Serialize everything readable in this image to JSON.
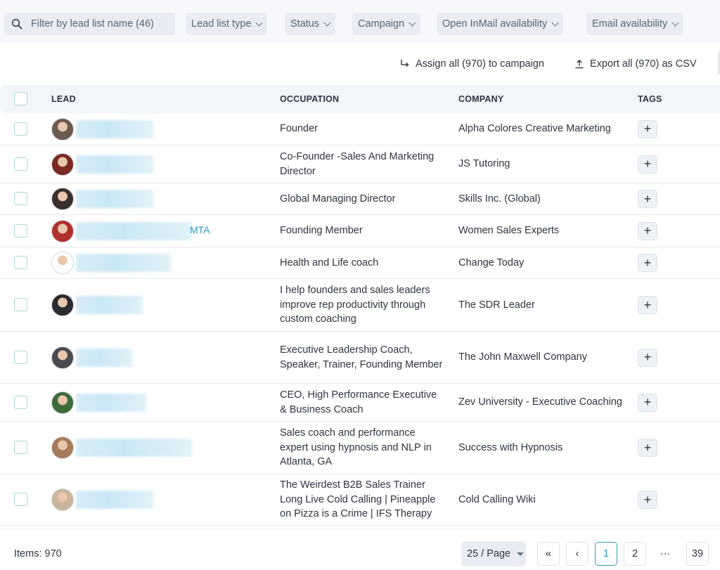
{
  "filters": {
    "search_placeholder": "Filter by lead list name (46)",
    "chips": [
      {
        "label": "Lead list type"
      },
      {
        "label": "Status"
      },
      {
        "label": "Campaign"
      },
      {
        "label": "Open InMail availability"
      },
      {
        "label": "Email availability"
      }
    ]
  },
  "actions": {
    "assign_label": "Assign all (970) to campaign",
    "export_label": "Export all (970) as CSV"
  },
  "table": {
    "columns": [
      "LEAD",
      "OCCUPATION",
      "COMPANY",
      "TAGS"
    ],
    "rows": [
      {
        "lead_suffix": "",
        "occupation": "Founder",
        "company": "Alpha Colores Creative Marketing",
        "tag_label": "+",
        "avatar_color": "#6b5a4e"
      },
      {
        "lead_suffix": "",
        "occupation": "Co-Founder -Sales And Marketing Director",
        "company": "JS Tutoring",
        "tag_label": "+",
        "avatar_color": "#7a2a22"
      },
      {
        "lead_suffix": "",
        "occupation": "Global Managing Director",
        "company": "Skills Inc. (Global)",
        "tag_label": "+",
        "avatar_color": "#3a2e2a"
      },
      {
        "lead_suffix": "MTA",
        "occupation": "Founding Member",
        "company": "Women Sales Experts",
        "tag_label": "+",
        "avatar_color": "#b0302e"
      },
      {
        "lead_suffix": "",
        "occupation": "Health and Life coach",
        "company": "Change Today",
        "tag_label": "+",
        "avatar_color": "#ffffff"
      },
      {
        "lead_suffix": "",
        "occupation": "I help founders and sales leaders improve rep productivity through custom coaching",
        "company": "The SDR Leader",
        "tag_label": "+",
        "avatar_color": "#2a2c30"
      },
      {
        "lead_suffix": "",
        "occupation": "Executive Leadership Coach, Speaker, Trainer, Founding Member",
        "company": "The John Maxwell Company",
        "tag_label": "+",
        "avatar_color": "#4a4a52"
      },
      {
        "lead_suffix": "",
        "occupation": "CEO, High Performance Executive & Business Coach",
        "company": "Zev University - Executive Coaching",
        "tag_label": "+",
        "avatar_color": "#3d6b3a"
      },
      {
        "lead_suffix": "",
        "occupation": "Sales coach and performance expert using hypnosis and NLP in Atlanta, GA",
        "company": "Success with Hypnosis",
        "tag_label": "+",
        "avatar_color": "#a77b5a"
      },
      {
        "lead_suffix": "",
        "occupation": "The Weirdest B2B Sales Trainer Long Live Cold Calling | Pineapple on Pizza is a Crime | IFS Therapy",
        "company": "Cold Calling Wiki",
        "tag_label": "+",
        "avatar_color": "#c9b79c"
      }
    ]
  },
  "footer": {
    "items_label": "Items: 970",
    "per_page": "25 / Page",
    "pages": [
      "«",
      "‹",
      "1",
      "2",
      "···",
      "39"
    ],
    "current_page": "1"
  },
  "colors": {
    "accent": "#2a9dbd",
    "checkbox_border": "#a9d9d3",
    "header_bg": "#f2f5f9"
  }
}
